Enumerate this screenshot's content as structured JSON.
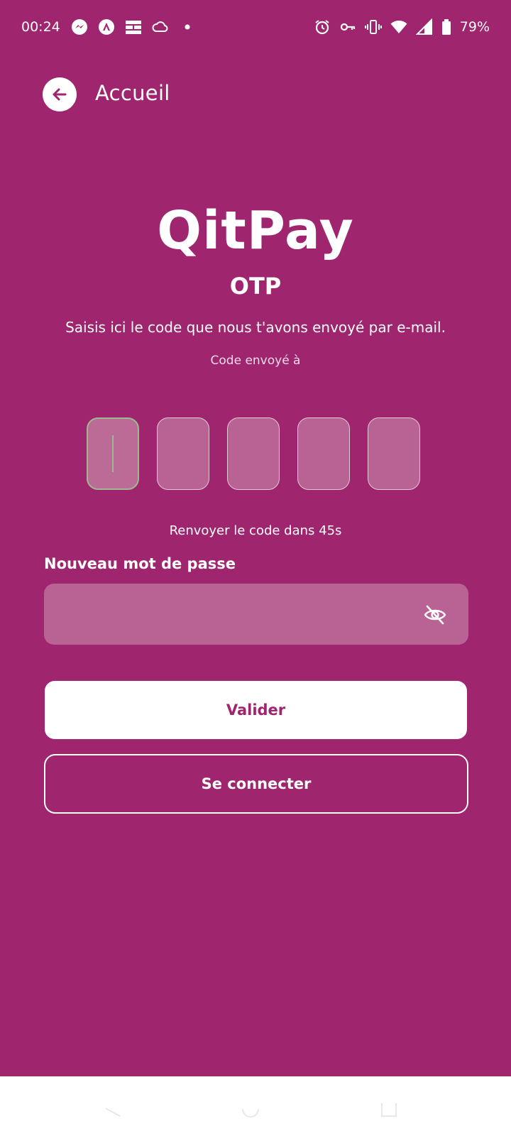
{
  "status_bar": {
    "time": "00:24",
    "battery": "79%",
    "left_icons": [
      "messenger-icon",
      "app-a-icon",
      "wall-icon",
      "cloud-icon",
      "dot-icon"
    ],
    "right_icons": [
      "alarm-icon",
      "key-icon",
      "vibrate-icon",
      "wifi-icon",
      "signal-icon",
      "battery-icon"
    ]
  },
  "header": {
    "back_label": "Accueil"
  },
  "brand": {
    "name": "QitPay"
  },
  "otp": {
    "title": "OTP",
    "instruction": "Saisis ici le code que nous t'avons envoyé par e-mail.",
    "sent_to": "Code envoyé à",
    "digits": [
      "",
      "",
      "",
      "",
      ""
    ],
    "resend": "Renvoyer le code dans 45s"
  },
  "password": {
    "label": "Nouveau mot de passe",
    "value": "",
    "toggle_icon": "eye-off-icon"
  },
  "actions": {
    "validate_label": "Valider",
    "login_label": "Se connecter"
  },
  "colors": {
    "background": "#9e256e",
    "field": "#b96395",
    "button": "#ffffff"
  }
}
